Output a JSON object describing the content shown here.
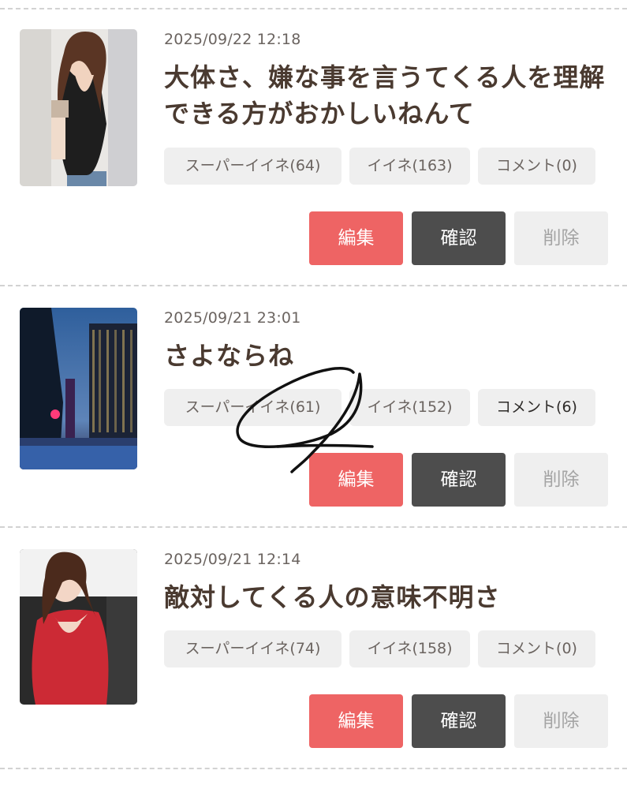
{
  "posts": [
    {
      "date": "2025/09/22 12:18",
      "title": "大体さ、嫌な事を言うてくる人を理解できる方がおかしいねんて",
      "stats": {
        "super_like": "スーパーイイネ(64)",
        "like": "イイネ(163)",
        "comment": "コメント(0)"
      },
      "actions": {
        "edit": "編集",
        "confirm": "確認",
        "delete": "削除"
      }
    },
    {
      "date": "2025/09/21 23:01",
      "title": "さよならね",
      "stats": {
        "super_like": "スーパーイイネ(61)",
        "like": "イイネ(152)",
        "comment": "コメント(6)"
      },
      "actions": {
        "edit": "編集",
        "confirm": "確認",
        "delete": "削除"
      }
    },
    {
      "date": "2025/09/21 12:14",
      "title": "敵対してくる人の意味不明さ",
      "stats": {
        "super_like": "スーパーイイネ(74)",
        "like": "イイネ(158)",
        "comment": "コメント(0)"
      },
      "actions": {
        "edit": "編集",
        "confirm": "確認",
        "delete": "削除"
      }
    }
  ],
  "colors": {
    "edit_button": "#ee6464",
    "confirm_button": "#4d4d4d",
    "delete_button": "#efefef",
    "chip_background": "#efefef",
    "title_text": "#4a3a30"
  }
}
